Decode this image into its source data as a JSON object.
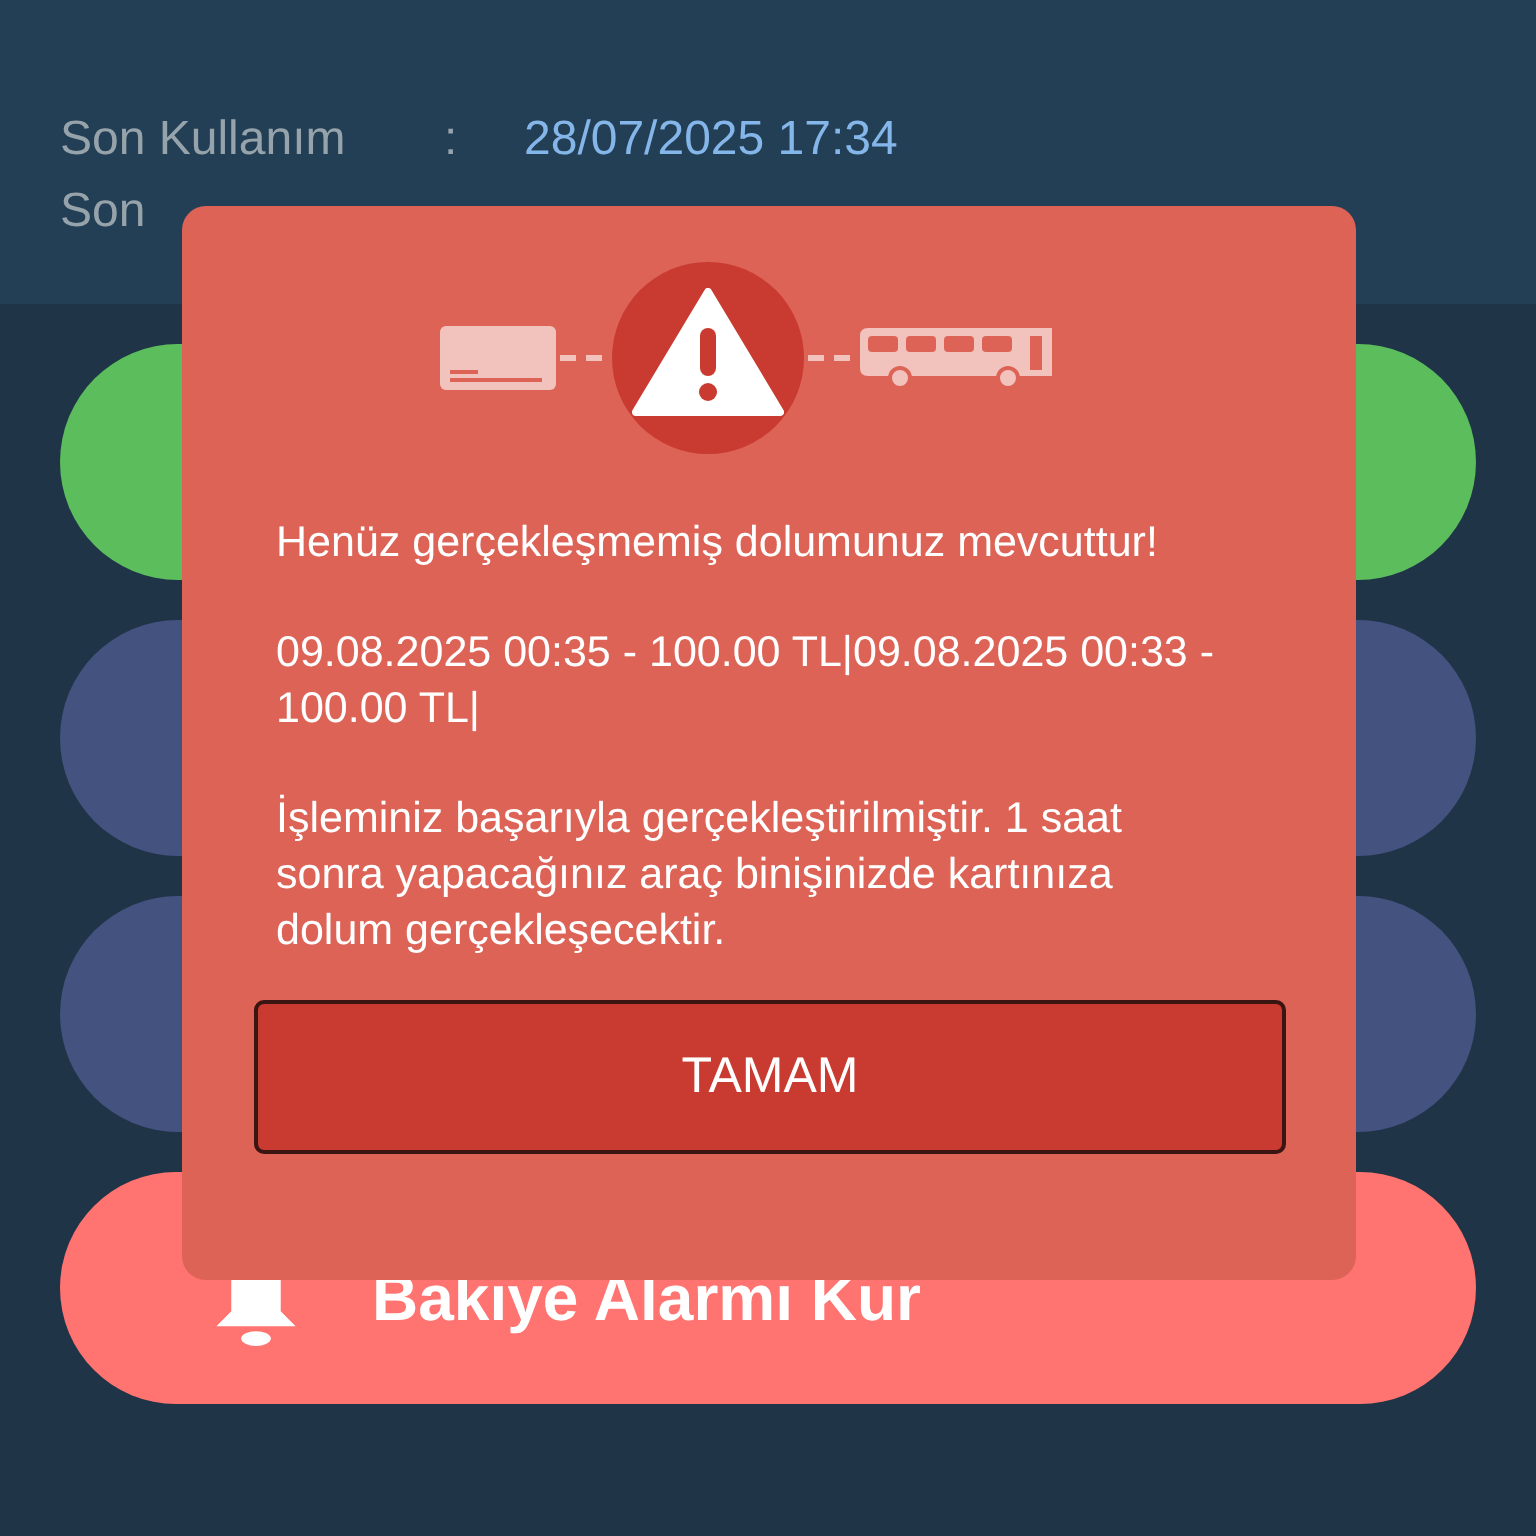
{
  "info": [
    {
      "label": "Son Kullanım",
      "separator": ":",
      "value": "28/07/2025 17:34"
    },
    {
      "label": "Son"
    }
  ],
  "menu": [
    {
      "kind": "green"
    },
    {
      "kind": "blue"
    },
    {
      "kind": "blue"
    },
    {
      "kind": "alarm",
      "label": "Bakiye Alarmı Kur"
    }
  ],
  "dialog": {
    "message": "Henüz gerçekleşmemiş dolumunuz mevcuttur!",
    "details": "09.08.2025 00:35 - 100.00 TL|09.08.2025 00:33 - 100.00 TL|",
    "note": "İşleminiz başarıyla gerçekleştirilmiştir. 1 saat sonra yapacağınız araç binişinizde kartınıza dolum gerçekleşecektir.",
    "button": "TAMAM"
  }
}
